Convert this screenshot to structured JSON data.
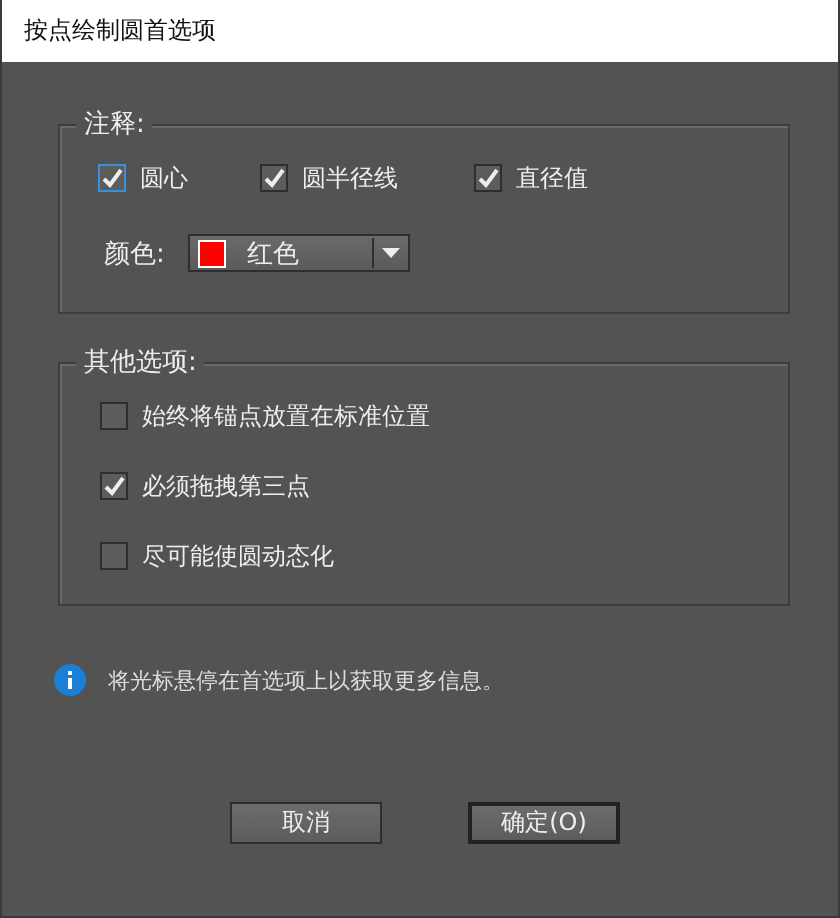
{
  "window": {
    "title": "按点绘制圆首选项"
  },
  "annotation_group": {
    "title": "注释:",
    "checkboxes": [
      {
        "label": "圆心",
        "checked": true,
        "focused": true
      },
      {
        "label": "圆半径线",
        "checked": true,
        "focused": false
      },
      {
        "label": "直径值",
        "checked": true,
        "focused": false
      }
    ],
    "color_dropdown": {
      "label": "颜色:",
      "value": "红色",
      "color": "#ff0000"
    }
  },
  "other_group": {
    "title": "其他选项:",
    "checkboxes": [
      {
        "label": "始终将锚点放置在标准位置",
        "checked": false
      },
      {
        "label": "必须拖拽第三点",
        "checked": true
      },
      {
        "label": "尽可能使圆动态化",
        "checked": false
      }
    ]
  },
  "info": "将光标悬停在首选项上以获取更多信息。",
  "buttons": [
    {
      "label": "取消",
      "default": false
    },
    {
      "label": "确定(O)",
      "default": true
    }
  ]
}
